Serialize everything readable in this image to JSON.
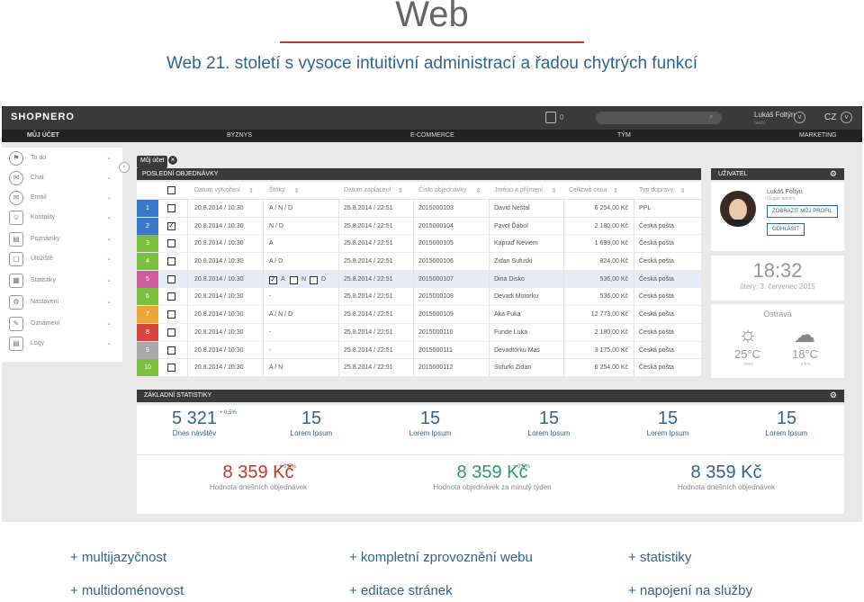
{
  "header": {
    "title": "Web",
    "subtitle": "Web 21. století s vysoce intuitivní administrací a řadou chytrých funkcí"
  },
  "topbar": {
    "logo": "SHOPNERO",
    "cart_count": "0",
    "user_name": "Lukáš Foltýn",
    "user_role": "(web)",
    "lang": "CZ"
  },
  "nav": {
    "items": [
      "MŮJ ÚČET",
      "BYZNYS",
      "E-COMMERCE",
      "TÝM",
      "MARKETING"
    ]
  },
  "sidebar": {
    "items": [
      {
        "label": "To do",
        "icon": "flag-icon"
      },
      {
        "label": "Chat",
        "icon": "chat-icon"
      },
      {
        "label": "Email",
        "icon": "email-icon"
      },
      {
        "label": "Kontakty",
        "icon": "contacts-icon"
      },
      {
        "label": "Poznámky",
        "icon": "notes-icon"
      },
      {
        "label": "Úložiště",
        "icon": "storage-icon"
      },
      {
        "label": "Statistiky",
        "icon": "stats-icon"
      },
      {
        "label": "Nastavení",
        "icon": "gear-icon"
      },
      {
        "label": "Oznámení",
        "icon": "notification-icon"
      },
      {
        "label": "Logy",
        "icon": "log-icon"
      }
    ]
  },
  "breadcrumb": {
    "label": "Můj účet"
  },
  "orders": {
    "title": "POSLEDNÍ OBJEDNÁVKY",
    "columns": [
      "Datum vytvoření",
      "Štítky",
      "Datum zaplacení",
      "Číslo objednávky",
      "Jméno a příjmení",
      "Celková cena",
      "Typ dopravy"
    ],
    "rows": [
      {
        "n": "1",
        "color": "#3b78c9",
        "checked": false,
        "created": "20.8.2014 / 10:30",
        "tags": "A / N / D",
        "paid": "25.8.2014 / 22:51",
        "order": "2015000103",
        "name": "David Neštal",
        "price": "6 254,00 Kč",
        "ship": "PPL"
      },
      {
        "n": "2",
        "color": "#3b78c9",
        "checked": true,
        "created": "20.8.2014 / 10:30",
        "tags": "N / D",
        "paid": "25.8.2014 / 22:51",
        "order": "2015000104",
        "name": "Pavol Ďábol",
        "price": "2 180,00 Kč",
        "ship": "Česká pošta"
      },
      {
        "n": "3",
        "color": "#7dc03d",
        "checked": false,
        "created": "20.8.2014 / 10:30",
        "tags": "A",
        "paid": "25.8.2014 / 22:51",
        "order": "2015000105",
        "name": "Kapraď Neviem",
        "price": "1 699,00 Kč",
        "ship": "Česká pošta"
      },
      {
        "n": "4",
        "color": "#7dc03d",
        "checked": false,
        "created": "20.8.2014 / 10:30",
        "tags": "A / D",
        "paid": "25.8.2014 / 22:51",
        "order": "2015000106",
        "name": "Zidan Sufuski",
        "price": "824,00 Kč",
        "ship": "Česká pošta"
      },
      {
        "n": "5",
        "color": "#d05ba1",
        "checked": false,
        "created": "20.8.2014 / 10:30",
        "tags": "",
        "paid": "25.8.2014 / 22:51",
        "order": "2015000107",
        "name": "Dina Disko",
        "price": "536,00 Kč",
        "ship": "Česká pošta"
      },
      {
        "n": "6",
        "color": "#7dc03d",
        "checked": false,
        "created": "20.8.2014 / 10:30",
        "tags": "-",
        "paid": "25.8.2014 / 22:51",
        "order": "2015000108",
        "name": "Devadi Motorku",
        "price": "536,00 Kč",
        "ship": "Česká pošta"
      },
      {
        "n": "7",
        "color": "#f0a33a",
        "checked": false,
        "created": "20.8.2014 / 10:30",
        "tags": "A / N / D",
        "paid": "25.8.2014 / 22:51",
        "order": "2015000109",
        "name": "Aka Fuka",
        "price": "12 773,00 Kč",
        "ship": "Česká pošta"
      },
      {
        "n": "8",
        "color": "#d9453d",
        "checked": false,
        "created": "20.8.2014 / 10:30",
        "tags": "-",
        "paid": "25.8.2014 / 22:51",
        "order": "2015000110",
        "name": "Funde Luka",
        "price": "2 180,00 Kč",
        "ship": "Česká pošta"
      },
      {
        "n": "9",
        "color": "#a8a8a8",
        "checked": false,
        "created": "20.8.2014 / 10:30",
        "tags": "-",
        "paid": "25.8.2014 / 22:51",
        "order": "2015000111",
        "name": "Devadtorku Mas",
        "price": "3 175,00 Kč",
        "ship": "Česká pošta"
      },
      {
        "n": "10",
        "color": "#7dc03d",
        "checked": false,
        "created": "20.8.2014 / 10:30",
        "tags": "A / N",
        "paid": "25.8.2014 / 22:51",
        "order": "2015000112",
        "name": "Sufurki Zidan",
        "price": "6 254,00 Kč",
        "ship": "Česká pošta"
      }
    ],
    "row5_tags": {
      "a": "A",
      "n": "N",
      "d": "D"
    }
  },
  "user_panel": {
    "title": "UŽIVATEL",
    "name": "Lukáš Foltýn",
    "role": "(Super admin)",
    "profile_btn": "ZOBRAZIT MŮJ PROFIL",
    "logout_btn": "ODHLÁSIT"
  },
  "clock": {
    "time": "18:32",
    "date": "úterý, 3. červenec 2015"
  },
  "weather": {
    "city": "Ostrava",
    "today_temp": "25°C",
    "today_label": "dnes",
    "tomorrow_temp": "18°C",
    "tomorrow_label": "zítra"
  },
  "stats": {
    "title": "ZÁKLADNÍ STATISTIKY",
    "top": [
      {
        "value": "5 321",
        "label": "Dnes návštěv",
        "delta": "+ 0,5%"
      },
      {
        "value": "15",
        "label": "Lorem Ipsum"
      },
      {
        "value": "15",
        "label": "Lorem Ipsum"
      },
      {
        "value": "15",
        "label": "Lorem Ipsum"
      },
      {
        "value": "15",
        "label": "Lorem Ipsum"
      },
      {
        "value": "15",
        "label": "Lorem Ipsum"
      }
    ],
    "bottom": [
      {
        "value": "8 359 Kč",
        "label": "Hodnota dnešních objednávek",
        "delta": "+ 0,5%",
        "color": "#c0392b"
      },
      {
        "value": "8 359 Kč",
        "label": "Hodnota objednávek za minulý týden",
        "delta": "+ 0,5%",
        "color": "#2e9a6c"
      },
      {
        "value": "8 359 Kč",
        "label": "Hodnota dnešních objednávek",
        "color": "#2f6690"
      }
    ]
  },
  "features": [
    "+ multijazyčnost",
    "+ kompletní zprovoznění webu",
    "+ statistiky",
    "+ multidoménovost",
    "+ editace stránek",
    "+ napojení na služby"
  ]
}
